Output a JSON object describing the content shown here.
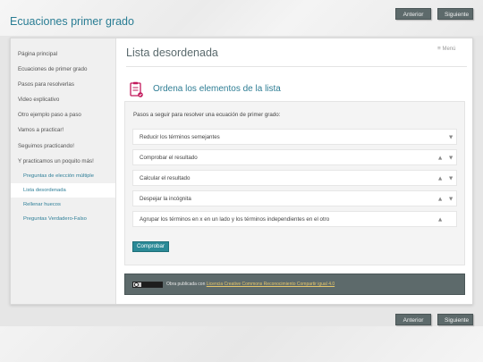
{
  "site": {
    "title": "Ecuaciones primer grado"
  },
  "nav": {
    "prev_label": "Anterior",
    "next_label": "Siguiente"
  },
  "sidebar": {
    "items": [
      {
        "label": "Página principal"
      },
      {
        "label": "Ecuaciones de primer grado"
      },
      {
        "label": "Pasos para resolverlas"
      },
      {
        "label": "Video explicativo"
      },
      {
        "label": "Otro ejemplo paso a paso"
      },
      {
        "label": "Vamos a practicar!"
      },
      {
        "label": "Seguimos practicando!"
      },
      {
        "label": "Y practicamos un poquito más!"
      }
    ],
    "subitems": [
      {
        "label": "Preguntas de elección múltiple",
        "active": false
      },
      {
        "label": "Lista desordenada",
        "active": true
      },
      {
        "label": "Rellenar huecos",
        "active": false
      },
      {
        "label": "Preguntas Verdadero-Falso",
        "active": false
      }
    ]
  },
  "content": {
    "title": "Lista desordenada",
    "menu_label": "Menú",
    "activity_icon": "list-clipboard-icon",
    "activity_title": "Ordena los elementos de la lista",
    "instructions": "Pasos a seguir para resolver una ecuación de primer grado:",
    "items": [
      {
        "label": "Reducir los términos semejantes",
        "up": false,
        "down": true
      },
      {
        "label": "Comprobar el resultado",
        "up": true,
        "down": true
      },
      {
        "label": "Calcular el resultado",
        "up": true,
        "down": true
      },
      {
        "label": "Despejar la incógnita",
        "up": true,
        "down": true
      },
      {
        "label": "Agrupar los términos en x en un lado y los términos independientes en el otro",
        "up": true,
        "down": false
      }
    ],
    "check_label": "Comprobar"
  },
  "footer": {
    "text": "Obra publicada con",
    "link": "Licencia Creative Commons Reconocimiento Compartir igual 4.0"
  },
  "colors": {
    "accent": "#2e7d94",
    "button": "#5d6a6b",
    "icon": "#c2185b"
  }
}
